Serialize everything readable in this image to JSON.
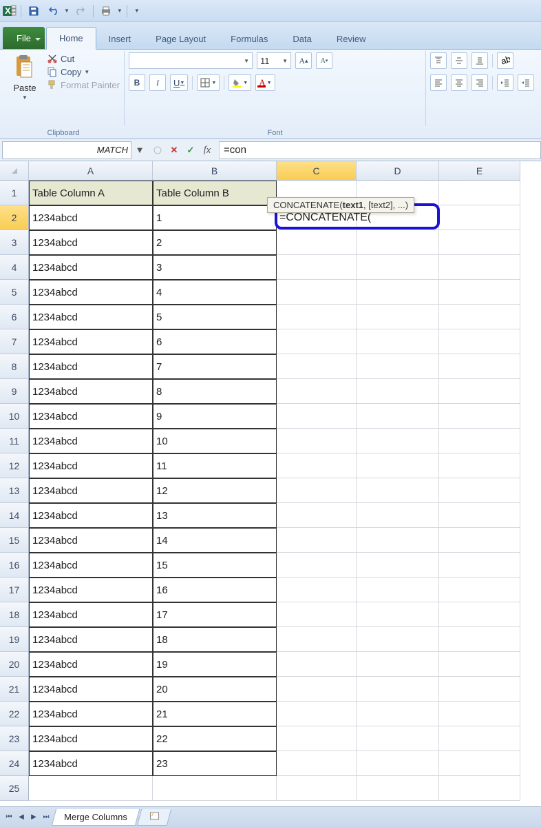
{
  "qat": {
    "save_tooltip": "Save",
    "undo_tooltip": "Undo",
    "redo_tooltip": "Redo"
  },
  "tabs": [
    "File",
    "Home",
    "Insert",
    "Page Layout",
    "Formulas",
    "Data",
    "Review"
  ],
  "activeTab": "Home",
  "ribbon": {
    "clipboard": {
      "group_label": "Clipboard",
      "paste": "Paste",
      "cut": "Cut",
      "copy": "Copy",
      "format_painter": "Format Painter"
    },
    "font": {
      "group_label": "Font",
      "font_size": "11",
      "bold": "B",
      "italic": "I",
      "underline": "U"
    }
  },
  "namebox_value": "MATCH",
  "formula_bar_value": "=con",
  "columns": [
    "A",
    "B",
    "C",
    "D",
    "E"
  ],
  "activeColumn": "C",
  "activeRow": 2,
  "headerRow": {
    "A": "Table Column A",
    "B": "Table Column B"
  },
  "formula_cell_text": "=CONCATENATE(",
  "tooltip": {
    "fn": "CONCATENATE",
    "sig_bold": "text1",
    "sig_rest": ", [text2], ...)"
  },
  "dataRows": [
    {
      "A": "1234abcd",
      "B": "1"
    },
    {
      "A": "1234abcd",
      "B": "2"
    },
    {
      "A": "1234abcd",
      "B": "3"
    },
    {
      "A": "1234abcd",
      "B": "4"
    },
    {
      "A": "1234abcd",
      "B": "5"
    },
    {
      "A": "1234abcd",
      "B": "6"
    },
    {
      "A": "1234abcd",
      "B": "7"
    },
    {
      "A": "1234abcd",
      "B": "8"
    },
    {
      "A": "1234abcd",
      "B": "9"
    },
    {
      "A": "1234abcd",
      "B": "10"
    },
    {
      "A": "1234abcd",
      "B": "11"
    },
    {
      "A": "1234abcd",
      "B": "12"
    },
    {
      "A": "1234abcd",
      "B": "13"
    },
    {
      "A": "1234abcd",
      "B": "14"
    },
    {
      "A": "1234abcd",
      "B": "15"
    },
    {
      "A": "1234abcd",
      "B": "16"
    },
    {
      "A": "1234abcd",
      "B": "17"
    },
    {
      "A": "1234abcd",
      "B": "18"
    },
    {
      "A": "1234abcd",
      "B": "19"
    },
    {
      "A": "1234abcd",
      "B": "20"
    },
    {
      "A": "1234abcd",
      "B": "21"
    },
    {
      "A": "1234abcd",
      "B": "22"
    },
    {
      "A": "1234abcd",
      "B": "23"
    }
  ],
  "activeSheet": "Merge Columns"
}
